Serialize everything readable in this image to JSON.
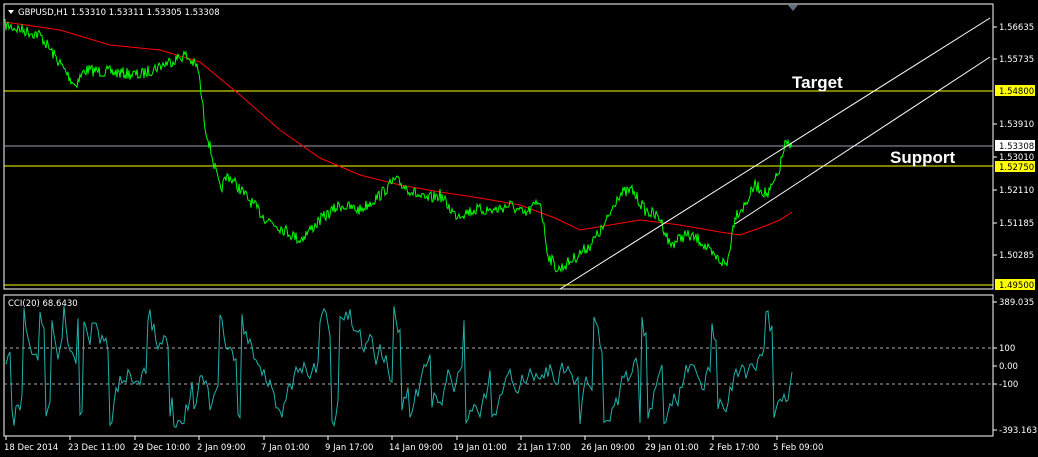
{
  "header": {
    "symbol_info": "GBPUSD,H1  1.53310 1.53311 1.53305 1.53308",
    "dropdown_icon": "triangle-down-icon"
  },
  "price_axis": {
    "ticks": [
      "1.56635",
      "1.55735",
      "1.53910",
      "1.53010",
      "1.52110",
      "1.51185",
      "1.50285"
    ],
    "levels": {
      "target": "1.54800",
      "current": "1.53308",
      "support": "1.52750",
      "bottom": "1.49500"
    }
  },
  "annotations": {
    "target": "Target",
    "support": "Support"
  },
  "indicator": {
    "title": "CCI(20) 68.6430",
    "ticks": [
      "389.035",
      "100",
      "0.00",
      "-100",
      "-393.163"
    ]
  },
  "time_axis": {
    "labels": [
      "18 Dec 2014",
      "23 Dec 11:00",
      "29 Dec 10:00",
      "2 Jan 09:00",
      "7 Jan 01:00",
      "9 Jan 17:00",
      "14 Jan 09:00",
      "19 Jan 01:00",
      "21 Jan 17:00",
      "26 Jan 09:00",
      "29 Jan 01:00",
      "2 Feb 17:00",
      "5 Feb 09:00"
    ]
  },
  "colors": {
    "background": "#000000",
    "price_line": "#00ff00",
    "moving_average": "#ff0000",
    "level_line": "#ffff00",
    "current_price_line": "#a0a0b0",
    "channel": "#ffffff",
    "cci": "#20b2aa",
    "axis": "#ffffff"
  }
}
